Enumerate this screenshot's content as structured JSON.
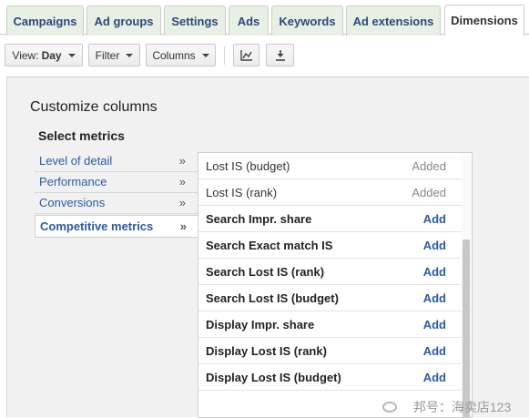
{
  "tabs": [
    {
      "label": "Campaigns"
    },
    {
      "label": "Ad groups"
    },
    {
      "label": "Settings"
    },
    {
      "label": "Ads"
    },
    {
      "label": "Keywords"
    },
    {
      "label": "Ad extensions"
    },
    {
      "label": "Dimensions",
      "active": true
    }
  ],
  "toolbar": {
    "view_prefix": "View:",
    "view_value": "Day",
    "filter_label": "Filter",
    "columns_label": "Columns",
    "chart_icon": "line-chart-icon",
    "download_icon": "download-icon"
  },
  "panel": {
    "title": "Customize columns",
    "section_title": "Select metrics"
  },
  "categories": [
    {
      "label": "Level of detail",
      "arrow": "»"
    },
    {
      "label": "Performance",
      "arrow": "»"
    },
    {
      "label": "Conversions",
      "arrow": "»"
    },
    {
      "label": "Competitive metrics",
      "arrow": "»",
      "selected": true
    }
  ],
  "metrics": [
    {
      "label": "Lost IS (budget)",
      "status": "Added"
    },
    {
      "label": "Lost IS (rank)",
      "status": "Added"
    },
    {
      "label": "Search Impr. share",
      "status": "Add"
    },
    {
      "label": "Search Exact match IS",
      "status": "Add"
    },
    {
      "label": "Search Lost IS (rank)",
      "status": "Add"
    },
    {
      "label": "Search Lost IS (budget)",
      "status": "Add"
    },
    {
      "label": "Display Impr. share",
      "status": "Add"
    },
    {
      "label": "Display Lost IS (rank)",
      "status": "Add"
    },
    {
      "label": "Display Lost IS (budget)",
      "status": "Add"
    }
  ],
  "watermark": {
    "text": "邦号：海卖店123"
  },
  "colors": {
    "link": "#2a5aa8",
    "tab_bg": "#e8efe5",
    "panel_bg": "#f1f1f1"
  }
}
